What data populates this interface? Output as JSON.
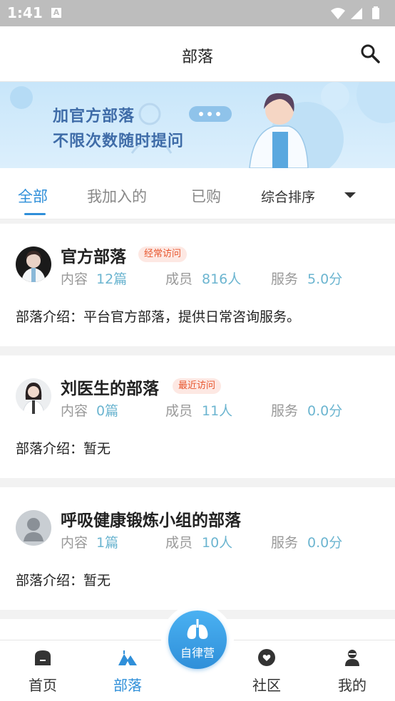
{
  "status_bar": {
    "time": "1:41",
    "notification_icon": "A"
  },
  "header": {
    "title": "部落"
  },
  "banner": {
    "line1": "加官方部落",
    "line2": "不限次数随时提问"
  },
  "tabs": [
    {
      "label": "全部",
      "active": true
    },
    {
      "label": "我加入的",
      "active": false
    },
    {
      "label": "已购",
      "active": false
    }
  ],
  "sort": {
    "label": "综合排序"
  },
  "tribes": [
    {
      "name": "官方部落",
      "badge": "经常访问",
      "content_label": "内容",
      "content_value": "12篇",
      "members_label": "成员",
      "members_value": "816人",
      "service_label": "服务",
      "service_value": "5.0分",
      "intro": "部落介绍：平台官方部落，提供日常咨询服务。"
    },
    {
      "name": "刘医生的部落",
      "badge": "最近访问",
      "content_label": "内容",
      "content_value": "0篇",
      "members_label": "成员",
      "members_value": "11人",
      "service_label": "服务",
      "service_value": "0.0分",
      "intro": "部落介绍：暂无"
    },
    {
      "name": "呼吸健康锻炼小组的部落",
      "badge": "",
      "content_label": "内容",
      "content_value": "1篇",
      "members_label": "成员",
      "members_value": "10人",
      "service_label": "服务",
      "service_value": "0.0分",
      "intro": "部落介绍：暂无"
    }
  ],
  "bottom_nav": {
    "home": "首页",
    "tribe": "部落",
    "center": "自律营",
    "community": "社区",
    "mine": "我的"
  },
  "colors": {
    "accent": "#2f8fd9",
    "stat_value": "#6cb5d0",
    "badge_text": "#e8562e",
    "badge_bg": "#fde8e3"
  }
}
